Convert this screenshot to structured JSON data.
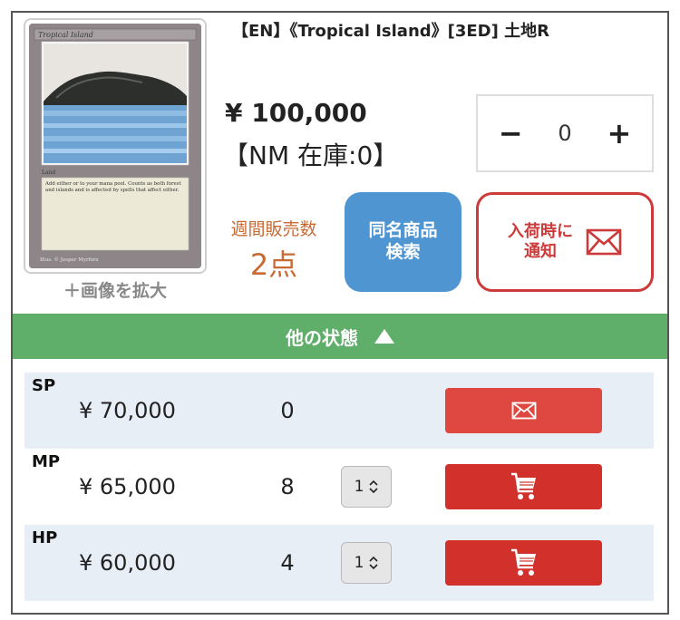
{
  "product": {
    "title": "【EN】《Tropical Island》[3ED] 土地R",
    "price": "¥ 100,000",
    "stock_label": "【NM 在庫:0】",
    "enlarge_label": "＋画像を拡大",
    "card_image": {
      "card_name": "Tropical Island",
      "type_line": "Land",
      "rules_text": "Add either or to your mana pool. Counts as both forest and islands and is affected by spells that affect either.",
      "artist": "Illus. © Jesper Myrfors"
    }
  },
  "quantity": {
    "minus": "−",
    "value": "0",
    "plus": "+"
  },
  "weekly_sales": {
    "label": "週間販売数",
    "count": "2点"
  },
  "buttons": {
    "same_name_search": "同名商品\n検索",
    "notify_line1": "入荷時に",
    "notify_line2": "通知"
  },
  "other_conditions": {
    "label": "他の状態",
    "icon": "triangle-up-icon"
  },
  "rows": [
    {
      "condition": "SP",
      "price": "¥ 70,000",
      "stock": "0",
      "select": null,
      "action": "mail-icon"
    },
    {
      "condition": "MP",
      "price": "¥ 65,000",
      "stock": "8",
      "select": "1",
      "action": "cart-icon"
    },
    {
      "condition": "HP",
      "price": "¥ 60,000",
      "stock": "4",
      "select": "1",
      "action": "cart-icon"
    }
  ],
  "colors": {
    "accent_green": "#5fae6a",
    "search_blue": "#4e95d1",
    "alert_red": "#cc3b3b",
    "weekly_orange": "#c86a32",
    "row_alt": "#e8eef6"
  }
}
